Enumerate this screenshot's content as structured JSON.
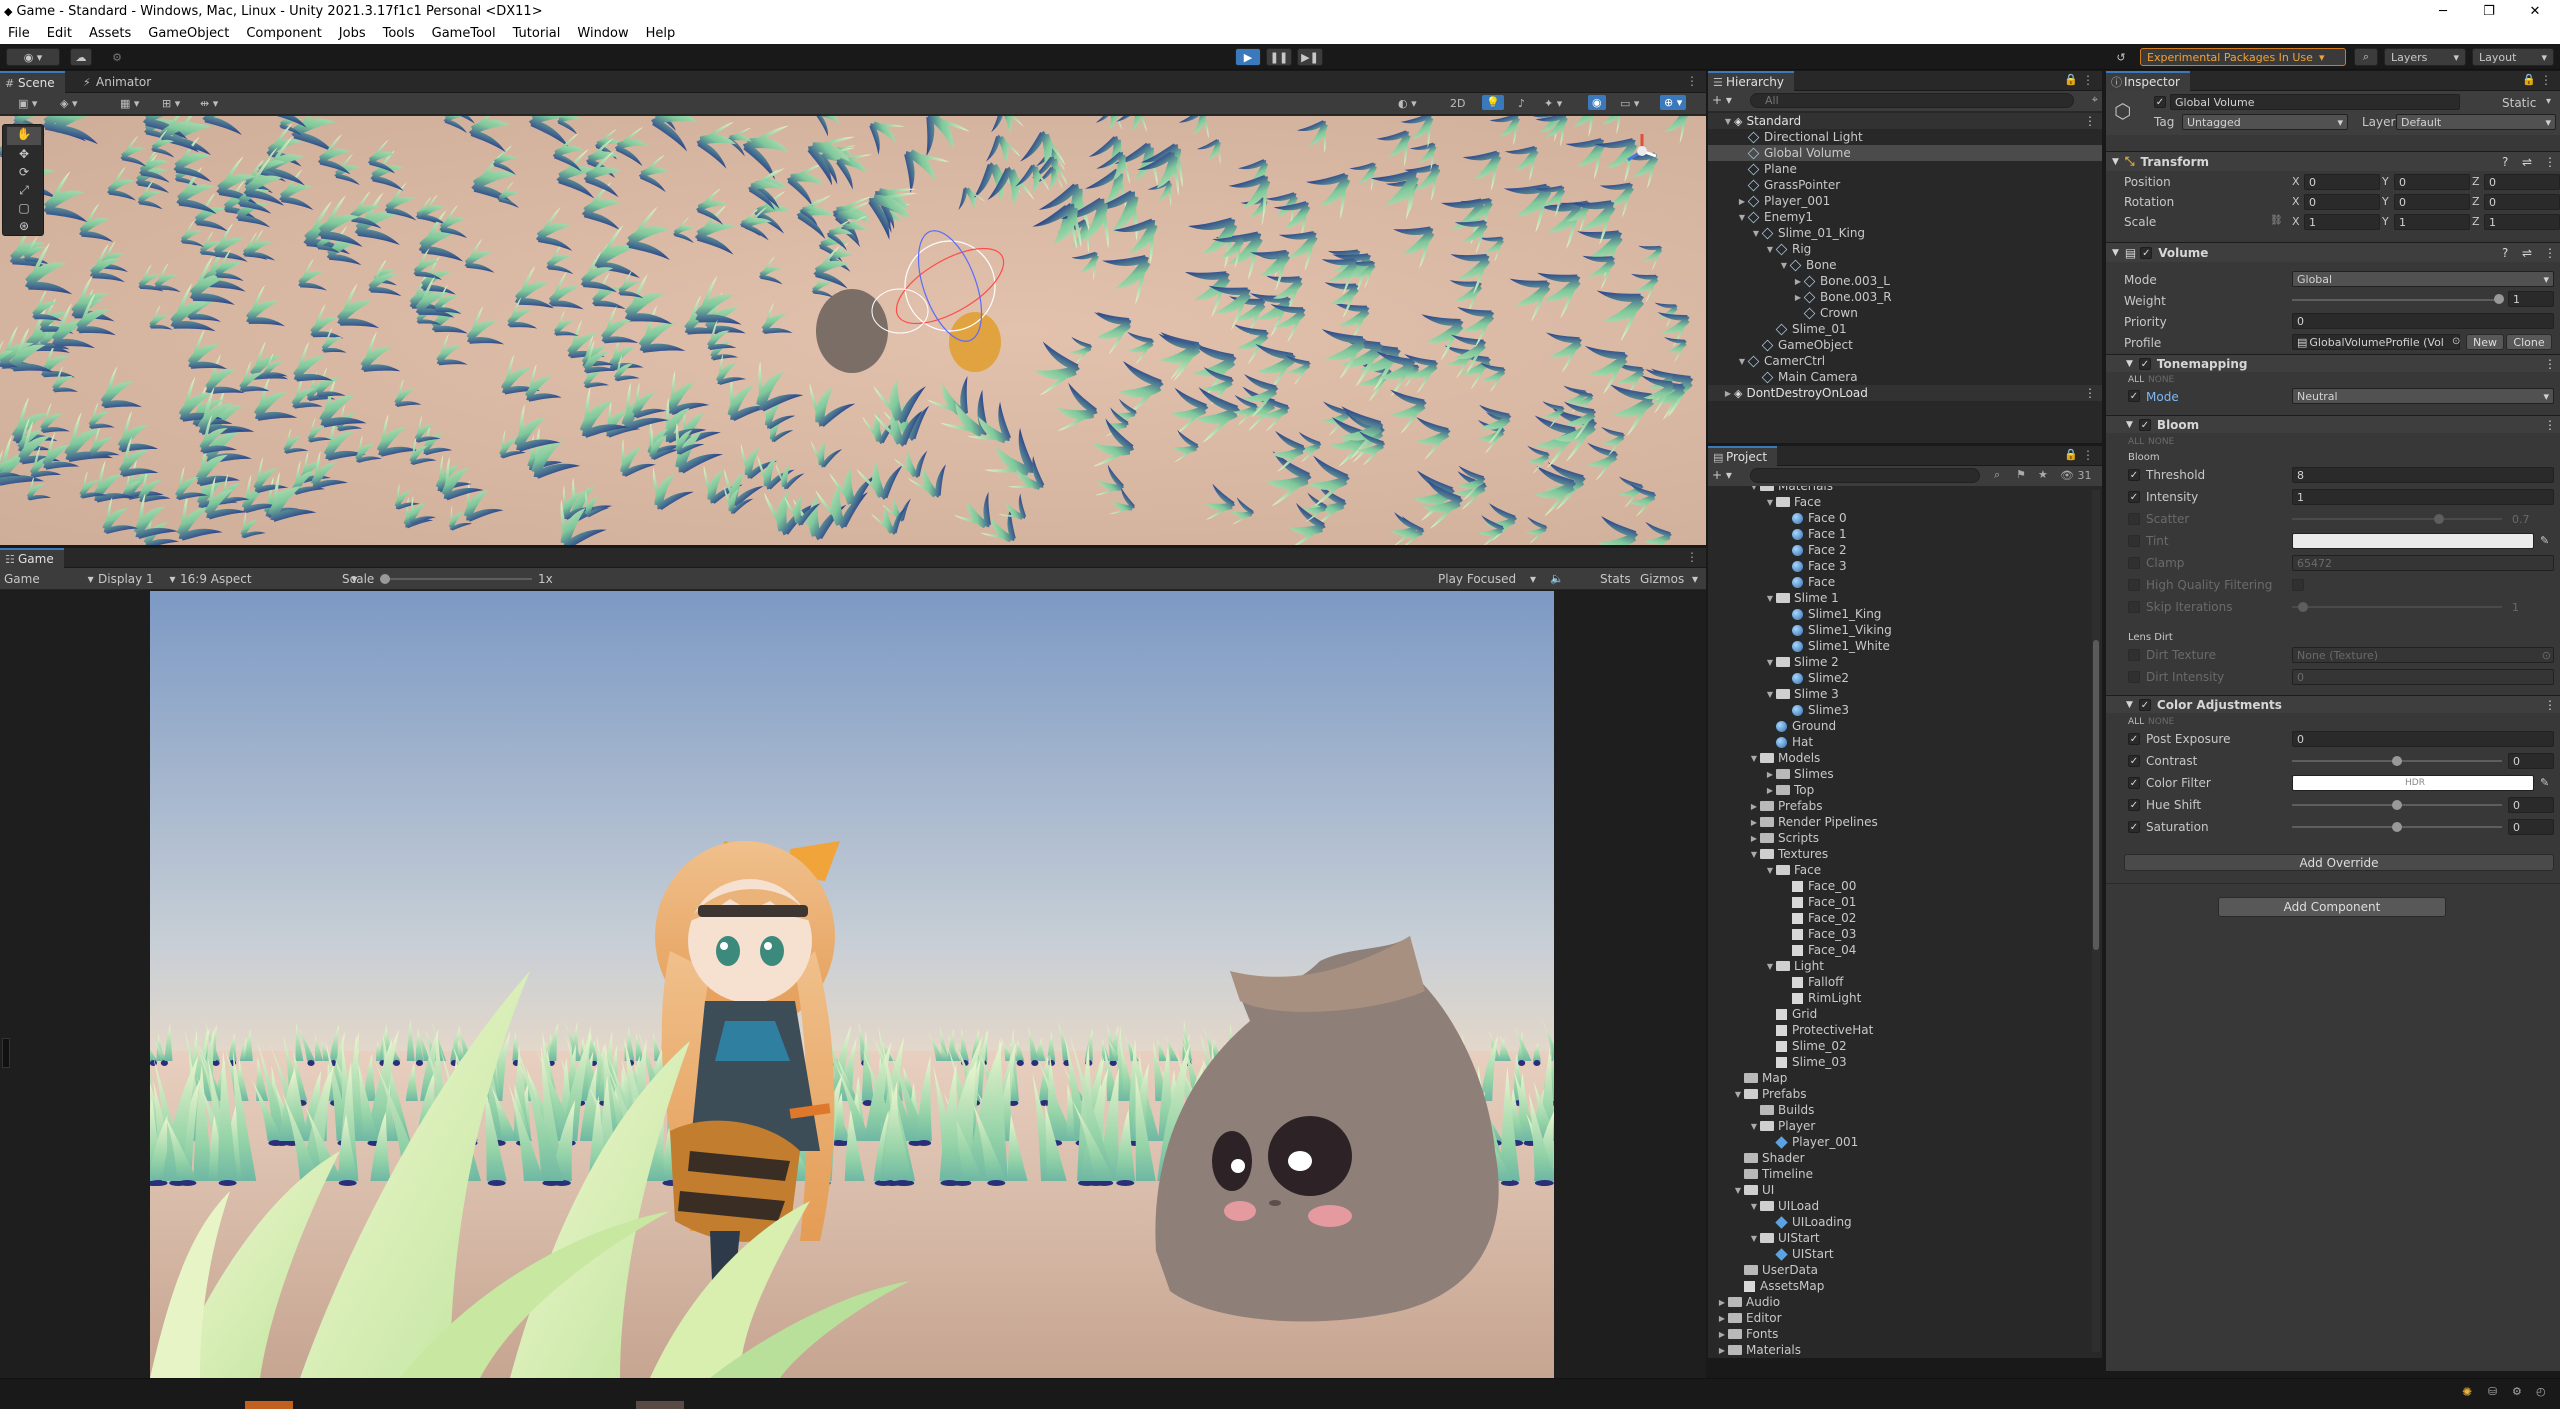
{
  "window": {
    "title": "Game - Standard - Windows, Mac, Linux - Unity 2021.3.17f1c1 Personal <DX11>"
  },
  "menu": [
    "File",
    "Edit",
    "Assets",
    "GameObject",
    "Component",
    "Jobs",
    "Tools",
    "GameTool",
    "Tutorial",
    "Window",
    "Help"
  ],
  "toolbar": {
    "experimental": "Experimental Packages In Use",
    "layers": "Layers",
    "layout": "Layout"
  },
  "scene": {
    "tabs": [
      "Scene",
      "Animator"
    ],
    "mode_2d": "2D"
  },
  "game": {
    "tab": "Game",
    "mode": "Game",
    "display": "Display 1",
    "aspect": "16:9 Aspect",
    "scale_label": "Scale",
    "scale_value": "1x",
    "play_focused": "Play Focused",
    "stats": "Stats",
    "gizmos": "Gizmos"
  },
  "hierarchy": {
    "title": "Hierarchy",
    "search_placeholder": "All",
    "items": [
      {
        "label": "Standard",
        "depth": 0,
        "icon": "scene",
        "arrow": "open"
      },
      {
        "label": "Directional Light",
        "depth": 1,
        "icon": "go",
        "arrow": ""
      },
      {
        "label": "Global Volume",
        "depth": 1,
        "icon": "go",
        "arrow": "",
        "selected": true
      },
      {
        "label": "Plane",
        "depth": 1,
        "icon": "go",
        "arrow": ""
      },
      {
        "label": "GrassPointer",
        "depth": 1,
        "icon": "go",
        "arrow": ""
      },
      {
        "label": "Player_001",
        "depth": 1,
        "icon": "go",
        "arrow": "closed"
      },
      {
        "label": "Enemy1",
        "depth": 1,
        "icon": "go",
        "arrow": "open"
      },
      {
        "label": "Slime_01_King",
        "depth": 2,
        "icon": "go",
        "arrow": "open"
      },
      {
        "label": "Rig",
        "depth": 3,
        "icon": "go",
        "arrow": "open"
      },
      {
        "label": "Bone",
        "depth": 4,
        "icon": "go",
        "arrow": "open"
      },
      {
        "label": "Bone.003_L",
        "depth": 5,
        "icon": "go",
        "arrow": "closed"
      },
      {
        "label": "Bone.003_R",
        "depth": 5,
        "icon": "go",
        "arrow": "closed"
      },
      {
        "label": "Crown",
        "depth": 5,
        "icon": "go",
        "arrow": ""
      },
      {
        "label": "Slime_01",
        "depth": 3,
        "icon": "go",
        "arrow": ""
      },
      {
        "label": "GameObject",
        "depth": 2,
        "icon": "go",
        "arrow": ""
      },
      {
        "label": "CamerCtrl",
        "depth": 1,
        "icon": "go",
        "arrow": "open"
      },
      {
        "label": "Main Camera",
        "depth": 2,
        "icon": "go",
        "arrow": ""
      },
      {
        "label": "DontDestroyOnLoad",
        "depth": 0,
        "icon": "scene",
        "arrow": "closed"
      }
    ]
  },
  "project": {
    "title": "Project",
    "count": "31",
    "items": [
      {
        "label": "Materials",
        "depth": 2,
        "icon": "folder",
        "arrow": "open"
      },
      {
        "label": "Face",
        "depth": 3,
        "icon": "folder",
        "arrow": "open"
      },
      {
        "label": "Face 0",
        "depth": 4,
        "icon": "mat",
        "arrow": ""
      },
      {
        "label": "Face 1",
        "depth": 4,
        "icon": "mat",
        "arrow": ""
      },
      {
        "label": "Face 2",
        "depth": 4,
        "icon": "mat",
        "arrow": ""
      },
      {
        "label": "Face 3",
        "depth": 4,
        "icon": "mat",
        "arrow": ""
      },
      {
        "label": "Face",
        "depth": 4,
        "icon": "mat",
        "arrow": ""
      },
      {
        "label": "Slime 1",
        "depth": 3,
        "icon": "folder",
        "arrow": "open"
      },
      {
        "label": "Slime1_King",
        "depth": 4,
        "icon": "mat",
        "arrow": ""
      },
      {
        "label": "Slime1_Viking",
        "depth": 4,
        "icon": "mat",
        "arrow": ""
      },
      {
        "label": "Slime1_White",
        "depth": 4,
        "icon": "mat",
        "arrow": ""
      },
      {
        "label": "Slime 2",
        "depth": 3,
        "icon": "folder",
        "arrow": "open"
      },
      {
        "label": "Slime2",
        "depth": 4,
        "icon": "mat",
        "arrow": ""
      },
      {
        "label": "Slime 3",
        "depth": 3,
        "icon": "folder",
        "arrow": "open"
      },
      {
        "label": "Slime3",
        "depth": 4,
        "icon": "mat",
        "arrow": ""
      },
      {
        "label": "Ground",
        "depth": 3,
        "icon": "mat",
        "arrow": ""
      },
      {
        "label": "Hat",
        "depth": 3,
        "icon": "mat",
        "arrow": ""
      },
      {
        "label": "Models",
        "depth": 2,
        "icon": "folder",
        "arrow": "open"
      },
      {
        "label": "Slimes",
        "depth": 3,
        "icon": "folder",
        "arrow": "closed"
      },
      {
        "label": "Top",
        "depth": 3,
        "icon": "folder",
        "arrow": "closed"
      },
      {
        "label": "Prefabs",
        "depth": 2,
        "icon": "folder",
        "arrow": "closed"
      },
      {
        "label": "Render Pipelines",
        "depth": 2,
        "icon": "folder",
        "arrow": "closed"
      },
      {
        "label": "Scripts",
        "depth": 2,
        "icon": "folder",
        "arrow": "closed"
      },
      {
        "label": "Textures",
        "depth": 2,
        "icon": "folder",
        "arrow": "open"
      },
      {
        "label": "Face",
        "depth": 3,
        "icon": "folder",
        "arrow": "open"
      },
      {
        "label": "Face_00",
        "depth": 4,
        "icon": "tex",
        "arrow": ""
      },
      {
        "label": "Face_01",
        "depth": 4,
        "icon": "tex",
        "arrow": ""
      },
      {
        "label": "Face_02",
        "depth": 4,
        "icon": "tex",
        "arrow": ""
      },
      {
        "label": "Face_03",
        "depth": 4,
        "icon": "tex",
        "arrow": ""
      },
      {
        "label": "Face_04",
        "depth": 4,
        "icon": "tex",
        "arrow": ""
      },
      {
        "label": "Light",
        "depth": 3,
        "icon": "folder",
        "arrow": "open"
      },
      {
        "label": "Falloff",
        "depth": 4,
        "icon": "tex",
        "arrow": ""
      },
      {
        "label": "RimLight",
        "depth": 4,
        "icon": "tex",
        "arrow": ""
      },
      {
        "label": "Grid",
        "depth": 3,
        "icon": "tex",
        "arrow": ""
      },
      {
        "label": "ProtectiveHat",
        "depth": 3,
        "icon": "tex",
        "arrow": ""
      },
      {
        "label": "Slime_02",
        "depth": 3,
        "icon": "tex",
        "arrow": ""
      },
      {
        "label": "Slime_03",
        "depth": 3,
        "icon": "tex",
        "arrow": ""
      },
      {
        "label": "Map",
        "depth": 1,
        "icon": "folder",
        "arrow": ""
      },
      {
        "label": "Prefabs",
        "depth": 1,
        "icon": "folder",
        "arrow": "open"
      },
      {
        "label": "Builds",
        "depth": 2,
        "icon": "folder",
        "arrow": ""
      },
      {
        "label": "Player",
        "depth": 2,
        "icon": "folder",
        "arrow": "open"
      },
      {
        "label": "Player_001",
        "depth": 3,
        "icon": "prefab",
        "arrow": ""
      },
      {
        "label": "Shader",
        "depth": 1,
        "icon": "folder",
        "arrow": ""
      },
      {
        "label": "Timeline",
        "depth": 1,
        "icon": "folder",
        "arrow": ""
      },
      {
        "label": "UI",
        "depth": 1,
        "icon": "folder",
        "arrow": "open"
      },
      {
        "label": "UILoad",
        "depth": 2,
        "icon": "folder",
        "arrow": "open"
      },
      {
        "label": "UILoading",
        "depth": 3,
        "icon": "prefab",
        "arrow": ""
      },
      {
        "label": "UIStart",
        "depth": 2,
        "icon": "folder",
        "arrow": "open"
      },
      {
        "label": "UIStart",
        "depth": 3,
        "icon": "prefab",
        "arrow": ""
      },
      {
        "label": "UserData",
        "depth": 1,
        "icon": "folder",
        "arrow": ""
      },
      {
        "label": "AssetsMap",
        "depth": 1,
        "icon": "tex",
        "arrow": ""
      },
      {
        "label": "Audio",
        "depth": 0,
        "icon": "folder",
        "arrow": "closed"
      },
      {
        "label": "Editor",
        "depth": 0,
        "icon": "folder",
        "arrow": "closed"
      },
      {
        "label": "Fonts",
        "depth": 0,
        "icon": "folder",
        "arrow": "closed"
      },
      {
        "label": "Materials",
        "depth": 0,
        "icon": "folder",
        "arrow": "closed"
      }
    ]
  },
  "inspector": {
    "title": "Inspector",
    "object_name": "Global Volume",
    "static": "Static",
    "tag_label": "Tag",
    "tag_value": "Untagged",
    "layer_label": "Layer",
    "layer_value": "Default",
    "transform": {
      "title": "Transform",
      "rows": [
        {
          "label": "Position",
          "x": "0",
          "y": "0",
          "z": "0"
        },
        {
          "label": "Rotation",
          "x": "0",
          "y": "0",
          "z": "0"
        },
        {
          "label": "Scale",
          "x": "1",
          "y": "1",
          "z": "1"
        }
      ]
    },
    "volume": {
      "title": "Volume",
      "mode_label": "Mode",
      "mode_value": "Global",
      "weight_label": "Weight",
      "weight_value": "1",
      "priority_label": "Priority",
      "priority_value": "0",
      "profile_label": "Profile",
      "profile_value": "GlobalVolumeProfile (Vol",
      "new_btn": "New",
      "clone_btn": "Clone"
    },
    "tonemapping": {
      "title": "Tonemapping",
      "all": "ALL",
      "none": "NONE",
      "mode_label": "Mode",
      "mode_value": "Neutral"
    },
    "bloom": {
      "title": "Bloom",
      "all": "ALL",
      "none": "NONE",
      "sub": "Bloom",
      "threshold_label": "Threshold",
      "threshold_value": "8",
      "intensity_label": "Intensity",
      "intensity_value": "1",
      "scatter_label": "Scatter",
      "scatter_value": "0.7",
      "tint_label": "Tint",
      "clamp_label": "Clamp",
      "clamp_value": "65472",
      "hqf_label": "High Quality Filtering",
      "skip_label": "Skip Iterations",
      "skip_value": "1",
      "lens_dirt": "Lens Dirt",
      "dirt_tex_label": "Dirt Texture",
      "dirt_tex_value": "None (Texture)",
      "dirt_int_label": "Dirt Intensity",
      "dirt_int_value": "0"
    },
    "color_adjustments": {
      "title": "Color Adjustments",
      "all": "ALL",
      "none": "NONE",
      "post_label": "Post Exposure",
      "post_value": "0",
      "contrast_label": "Contrast",
      "contrast_value": "0",
      "filter_label": "Color Filter",
      "filter_hdr": "HDR",
      "hue_label": "Hue Shift",
      "hue_value": "0",
      "sat_label": "Saturation",
      "sat_value": "0"
    },
    "add_override": "Add Override",
    "add_component": "Add Component"
  }
}
